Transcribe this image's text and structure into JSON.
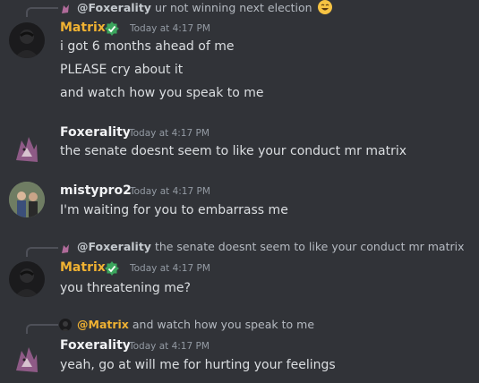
{
  "messages": [
    {
      "reply": {
        "author": "@Foxerality",
        "text": "ur not winning next election"
      },
      "author": "Matrix",
      "timestamp": "Today at 4:17 PM",
      "lines": [
        "i got 6 months ahead of me",
        "PLEASE cry about it",
        "and watch how you speak to me"
      ]
    },
    {
      "author": "Foxerality",
      "timestamp": "Today at 4:17 PM",
      "lines": [
        "the senate doesnt seem to like your conduct mr matrix"
      ]
    },
    {
      "author": "mistypro2",
      "timestamp": "Today at 4:17 PM",
      "lines": [
        "I'm waiting for you to embarrass me"
      ]
    },
    {
      "reply": {
        "author": "@Foxerality",
        "text": "the senate doesnt seem to like your conduct mr matrix"
      },
      "author": "Matrix",
      "timestamp": "Today at 4:17 PM",
      "lines": [
        "you threatening me?"
      ]
    },
    {
      "reply": {
        "author": "@Matrix",
        "text": "and watch how you speak to me"
      },
      "author": "Foxerality",
      "timestamp": "Today at 4:17 PM",
      "lines": [
        "yeah, go at will me for hurting your feelings"
      ]
    }
  ],
  "colors": {
    "background": "#313338",
    "matrix_name": "#f0b232",
    "badge": "#3ba55d"
  },
  "icons": [
    "laughing-emoji",
    "role-badge-icon"
  ]
}
